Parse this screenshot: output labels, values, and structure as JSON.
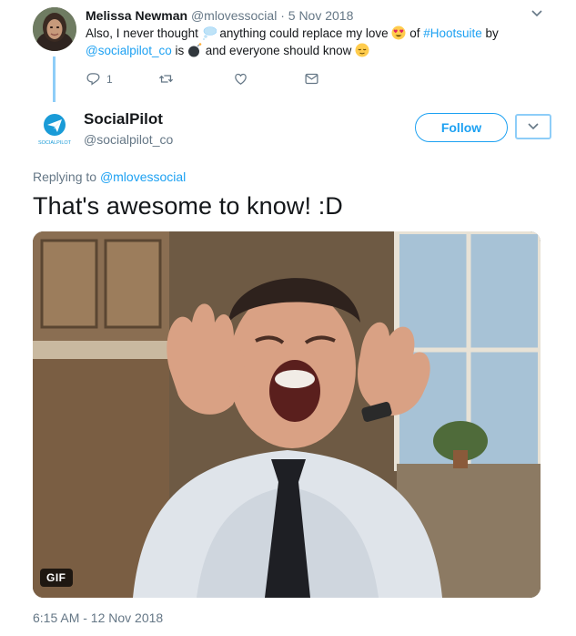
{
  "parent_tweet": {
    "name": "Melissa Newman",
    "handle": "@mlovessocial",
    "separator": " · ",
    "date": "5 Nov 2018",
    "text_parts": {
      "t1": "Also, I never thought ",
      "t2": " anything could replace my love ",
      "t3": " of ",
      "hashtag": "#Hootsuite",
      "t4": " by",
      "mention": "@socialpilot_co",
      "t5": " is ",
      "t6": " and everyone should know "
    },
    "reply_count": "1",
    "icons": [
      "reply-icon",
      "retweet-icon",
      "like-icon",
      "message-icon",
      "chevron-down-icon"
    ]
  },
  "main_tweet": {
    "name": "SocialPilot",
    "handle": "@socialpilot_co",
    "avatar_label": "SOCIALPILOT",
    "follow_label": "Follow",
    "replying_label": "Replying to ",
    "replying_handle": "@mlovessocial",
    "text": "That's awesome to know! :D",
    "media_badge": "GIF",
    "timestamp": "6:15 AM - 12 Nov 2018"
  },
  "colors": {
    "accent": "#1da1f2",
    "thread_line": "#8ecdf8",
    "secondary_text": "#657786"
  }
}
